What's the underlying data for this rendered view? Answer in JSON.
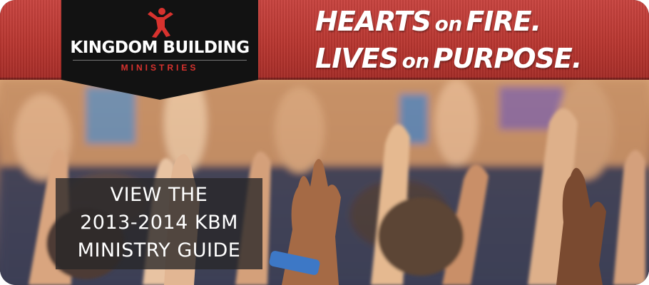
{
  "logo": {
    "name": "KINGDOM BUILDING",
    "subtitle": "MINISTRIES",
    "icon": "person-figure-icon",
    "accent_color": "#d8322e"
  },
  "tagline": {
    "line1": [
      "HEARTS",
      "on",
      "FIRE."
    ],
    "line2": [
      "LIVES",
      "on",
      "PURPOSE."
    ]
  },
  "guide": {
    "lines": [
      "VIEW THE",
      "2013-2014 KBM",
      "MINISTRY GUIDE"
    ]
  },
  "photo": {
    "description_icon": "crowd-raised-hands-image"
  },
  "colors": {
    "banner_red": "#b83630",
    "logo_black": "#121212"
  }
}
